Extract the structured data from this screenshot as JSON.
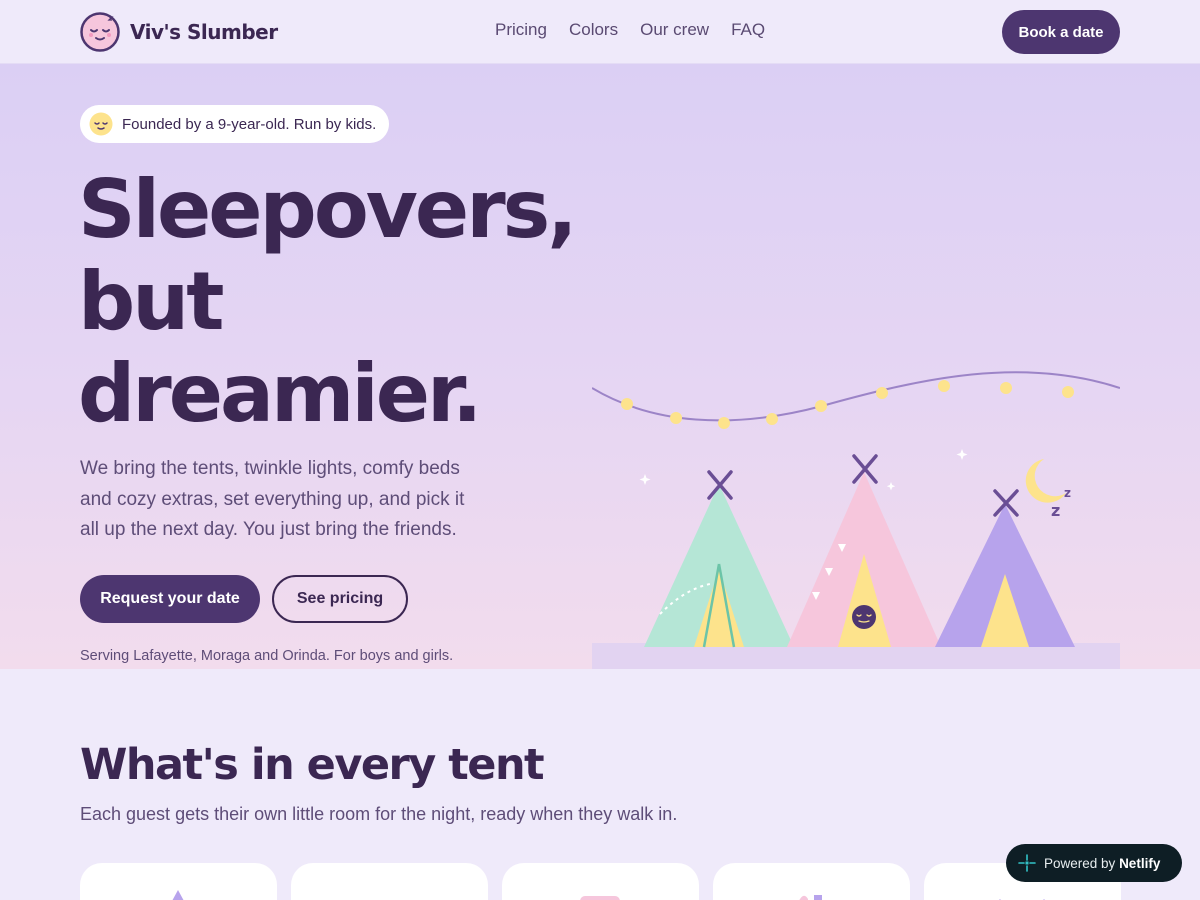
{
  "nav": {
    "brand": "Viv's Slumber",
    "links": [
      "Pricing",
      "Colors",
      "Our crew",
      "FAQ"
    ],
    "cta": "Book a date"
  },
  "hero": {
    "badge": "Founded by a 9-year-old. Run by kids.",
    "title_lines": [
      "Sleepovers,",
      "but",
      "dreamier."
    ],
    "subtitle": "We bring the tents, twinkle lights, comfy beds and cozy extras, set everything up, and pick it all up the next day. You just bring the friends.",
    "primary_button": "Request your date",
    "secondary_button": "See pricing",
    "serving": "Serving Lafayette, Moraga and Orinda. For boys and girls."
  },
  "section": {
    "title": "What's in every tent",
    "subtitle": "Each guest gets their own little room for the night, ready when they walk in."
  },
  "netlify": {
    "prefix": "Powered by",
    "brand": "Netlify"
  },
  "colors": {
    "primary": "#4d3670",
    "text": "#3b2752",
    "tent_mint": "#b5e6d6",
    "tent_pink": "#f6c6dc",
    "tent_lavender": "#b7a3ec",
    "tent_door": "#fbe296",
    "light_bulb": "#fde38c",
    "netlify_bg": "#0e1e25",
    "netlify_accent": "#32c3c8"
  },
  "icons": {
    "brand_logo": "sleeping-face-icon",
    "badge": "sleeping-face-icon",
    "netlify": "netlify-logo-icon",
    "moon": "crescent-moon-icon"
  }
}
